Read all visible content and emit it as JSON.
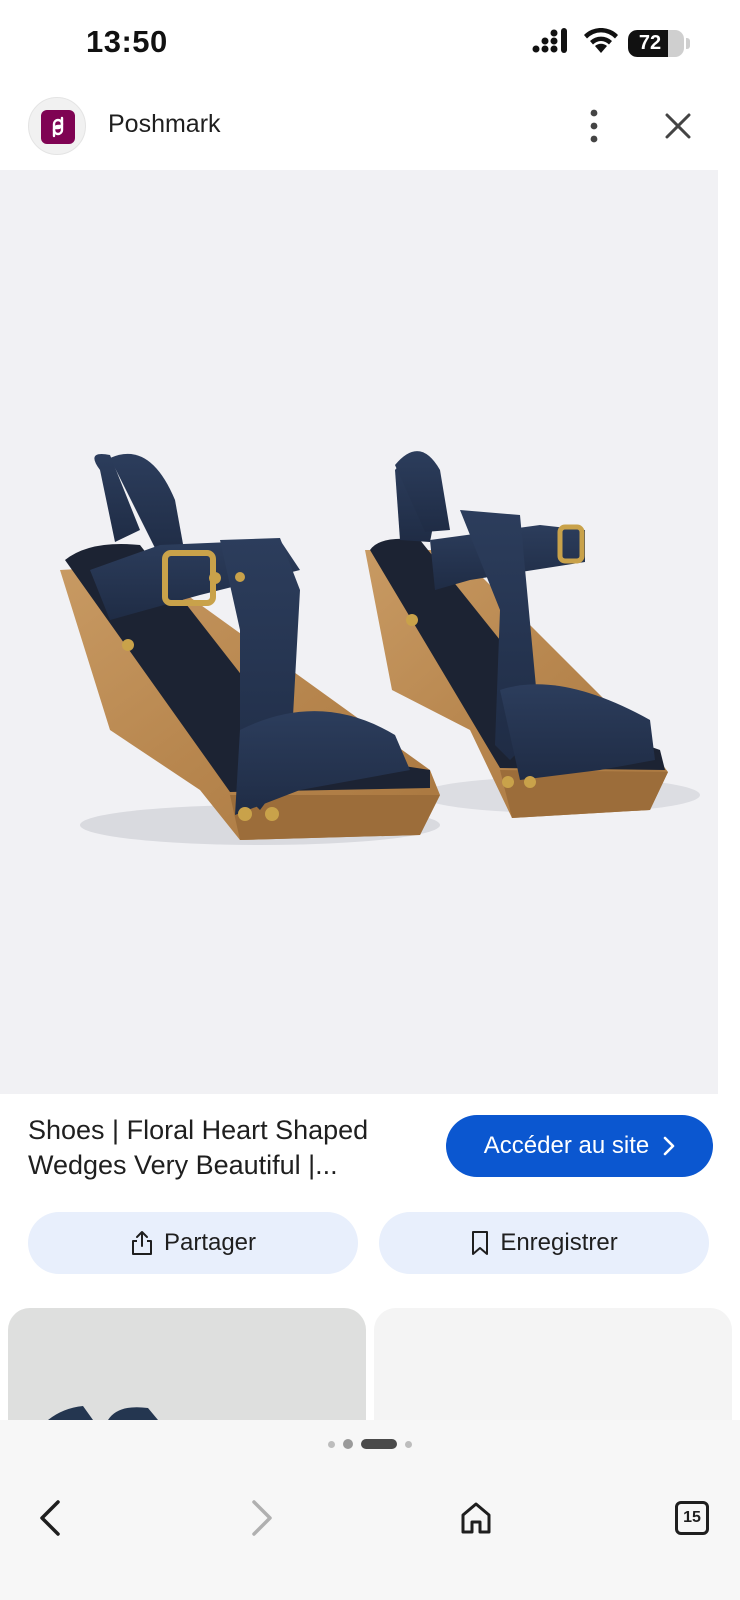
{
  "status_bar": {
    "time": "13:50",
    "battery": "72",
    "battery_level_percent": 72
  },
  "header": {
    "site_name": "Poshmark",
    "logo_icon": "poshmark-logo-icon",
    "more_icon": "more-vertical-icon",
    "close_icon": "close-icon"
  },
  "result": {
    "title": "Shoes | Floral Heart Shaped Wedges Very Beautiful |...",
    "visit_label": "Accéder au site",
    "share_label": "Partager",
    "save_label": "Enregistrer"
  },
  "pager": {
    "pages": 4,
    "active_index": 2
  },
  "bottom_bar": {
    "tabs_count": "15",
    "icons": [
      "back-arrow-icon",
      "forward-arrow-icon",
      "home-icon",
      "tabs-icon"
    ]
  },
  "colors": {
    "accent": "#0b57d0",
    "tonal_button": "#e8effc",
    "brand": "#7f0353"
  }
}
